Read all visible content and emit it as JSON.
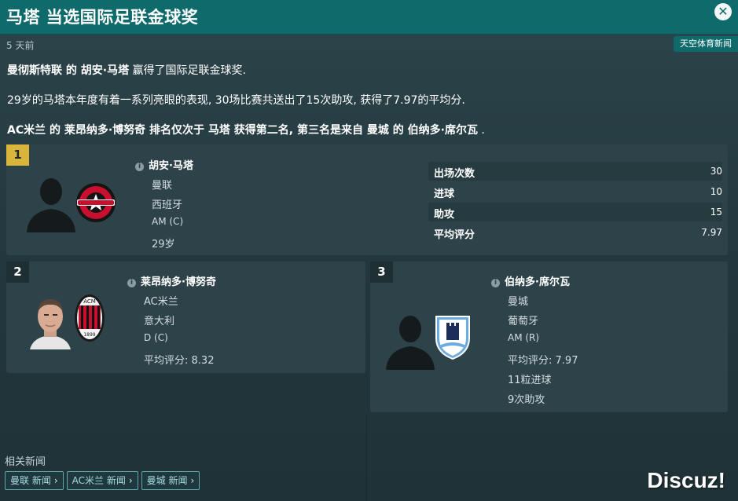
{
  "window": {
    "title": "马塔 当选国际足联金球奖",
    "close_icon": "close-icon",
    "time_ago": "5 天前",
    "source": "天空体育新闻"
  },
  "article": {
    "p1": {
      "club": "曼彻斯特联",
      "c1": " 的 ",
      "player": "胡安·马塔",
      "rest": " 赢得了国际足联金球奖."
    },
    "p2": "29岁的马塔本年度有着一系列亮眼的表现, 30场比赛共送出了15次助攻, 获得了7.97的平均分.",
    "p3": {
      "club2": "AC米兰",
      "c1": " 的 ",
      "player2": "莱昂纳多·博努奇",
      "c2": " 排名仅次于 ",
      "player1": "马塔",
      "c3": " 获得第二名, 第三名是来自 ",
      "club3": "曼城",
      "c4": " 的 ",
      "player3": "伯纳多·席尔瓦",
      "end": " ."
    }
  },
  "winners": [
    {
      "rank": "1",
      "name": "胡安·马塔",
      "club": "曼联",
      "nation": "西班牙",
      "position": "AM (C)",
      "age": "29岁",
      "stats": [
        {
          "label": "出场次数",
          "value": "30"
        },
        {
          "label": "进球",
          "value": "10"
        },
        {
          "label": "助攻",
          "value": "15"
        },
        {
          "label": "平均评分",
          "value": "7.97"
        }
      ]
    },
    {
      "rank": "2",
      "name": "莱昂纳多·博努奇",
      "club": "AC米兰",
      "nation": "意大利",
      "position": "D (C)",
      "rating_label": "平均评分",
      "rating_value": ": 8.32"
    },
    {
      "rank": "3",
      "name": "伯纳多·席尔瓦",
      "club": "曼城",
      "nation": "葡萄牙",
      "position": "AM (R)",
      "rating_label": "平均评分",
      "rating_value": ": 7.97",
      "goals": "11粒进球",
      "assists": "9次助攻"
    }
  ],
  "related": {
    "label": "相关新闻",
    "buttons": [
      "曼联 新闻",
      "AC米兰 新闻",
      "曼城 新闻"
    ]
  },
  "watermark": "Discuz!",
  "colors": {
    "header": "#0f6a6c",
    "gold": "#d9b53a",
    "card": "#2d4349"
  }
}
